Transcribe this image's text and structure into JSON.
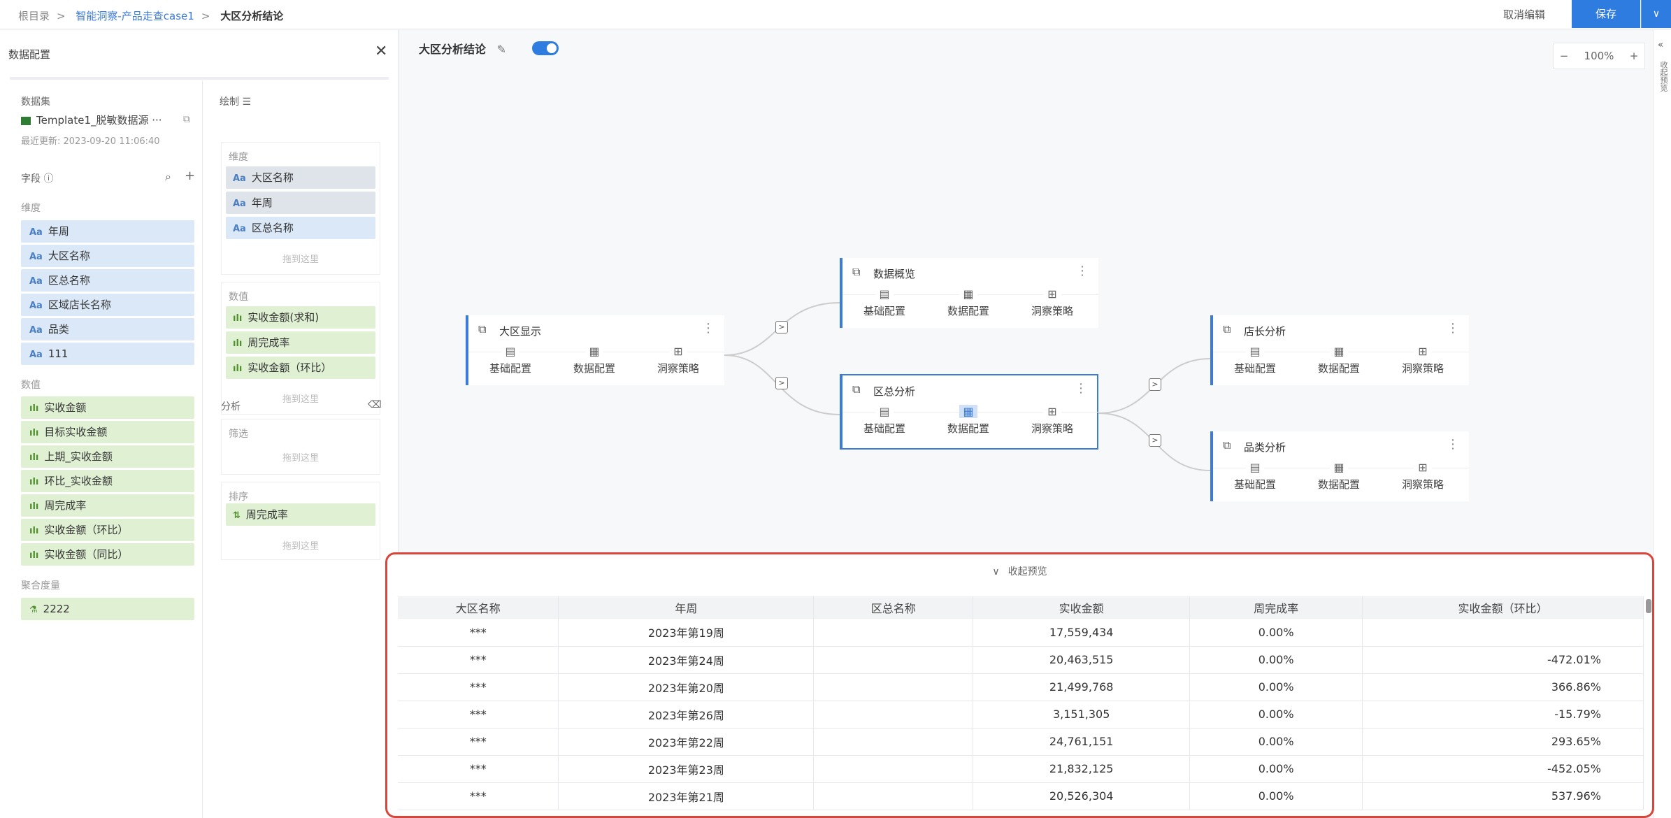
{
  "breadcrumb": {
    "root": "根目录",
    "project": "智能洞察-产品走查case1",
    "current": "大区分析结论"
  },
  "header": {
    "cancel": "取消编辑",
    "save": "保存",
    "save_arrow": "∨"
  },
  "left": {
    "title": "数据配置",
    "close": "✕",
    "dataset_label": "数据集",
    "dataset_name": "Template1_脱敏数据源 ···",
    "updated": "最近更新: 2023-09-20 11:06:40",
    "fields_label": "字段",
    "dim_label": "维度",
    "dims": [
      "年周",
      "大区名称",
      "区总名称",
      "区域店长名称",
      "品类",
      "111"
    ],
    "meas_label": "数值",
    "meas": [
      "实收金额",
      "目标实收金额",
      "上期_实收金额",
      "环比_实收金额",
      "周完成率",
      "实收金额（环比）",
      "实收金额（同比）"
    ],
    "agg_label": "聚合度量",
    "agg": [
      "2222"
    ]
  },
  "config": {
    "draw": "绘制",
    "dim_title": "维度",
    "dims": [
      "大区名称",
      "年周",
      "区总名称"
    ],
    "drop": "拖到这里",
    "val_title": "数值",
    "vals": [
      "实收金额(求和)",
      "周完成率",
      "实收金额（环比）"
    ],
    "analysis": "分析",
    "filter": "筛选",
    "sort": "排序",
    "sorts": [
      "周完成率"
    ]
  },
  "canvas": {
    "title": "大区分析结论",
    "zoom": "100%",
    "zoom_minus": "−",
    "zoom_plus": "+",
    "side_text": "收起预览"
  },
  "nodes": [
    {
      "title": "大区显示",
      "a1": "基础配置",
      "a2": "数据配置",
      "a3": "洞察策略"
    },
    {
      "title": "数据概览",
      "a1": "基础配置",
      "a2": "数据配置",
      "a3": "洞察策略"
    },
    {
      "title": "区总分析",
      "a1": "基础配置",
      "a2": "数据配置",
      "a3": "洞察策略"
    },
    {
      "title": "店长分析",
      "a1": "基础配置",
      "a2": "数据配置",
      "a3": "洞察策略"
    },
    {
      "title": "品类分析",
      "a1": "基础配置",
      "a2": "数据配置",
      "a3": "洞察策略"
    }
  ],
  "preview": {
    "toggle": "收起预览",
    "columns": [
      "大区名称",
      "年周",
      "区总名称",
      "实收金额",
      "周完成率",
      "实收金额（环比）"
    ],
    "rows": [
      [
        "***",
        "2023年第19周",
        "",
        "17,559,434",
        "0.00%",
        ""
      ],
      [
        "***",
        "2023年第24周",
        "",
        "20,463,515",
        "0.00%",
        "-472.01%"
      ],
      [
        "***",
        "2023年第20周",
        "",
        "21,499,768",
        "0.00%",
        "366.86%"
      ],
      [
        "***",
        "2023年第26周",
        "",
        "3,151,305",
        "0.00%",
        "-15.79%"
      ],
      [
        "***",
        "2023年第22周",
        "",
        "24,761,151",
        "0.00%",
        "293.65%"
      ],
      [
        "***",
        "2023年第23周",
        "",
        "21,832,125",
        "0.00%",
        "-452.05%"
      ],
      [
        "***",
        "2023年第21周",
        "",
        "20,526,304",
        "0.00%",
        "537.96%"
      ]
    ]
  }
}
